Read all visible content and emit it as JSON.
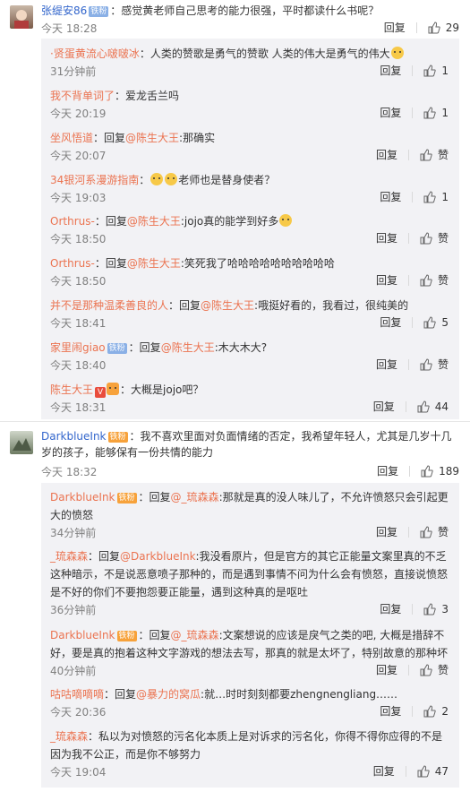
{
  "ui": {
    "reply_label": "回复",
    "like_label": "赞",
    "reply_prefix": "回复"
  },
  "comments": [
    {
      "user": "张缇安86",
      "badge": "铁粉",
      "text": "：感觉黄老师自己思考的能力很强，平时都读什么书呢？",
      "time": "今天 18:28",
      "likes": "29",
      "replies": [
        {
          "user": "·贤蛋黄流心啵啵冰",
          "text": "：人类的赞歌是勇气的赞歌 人类的伟大是勇气的伟大",
          "time": "31分钟前",
          "likes": "1"
        },
        {
          "user": "我不背单词了",
          "text": "：爱龙舌兰吗",
          "time": "今天 20:19",
          "likes": "1"
        },
        {
          "user": "坐风悟道",
          "text_pre": "：回复",
          "mention": "@陈生大王",
          "text": ":那确实",
          "time": "今天 20:07",
          "likes": "赞"
        },
        {
          "user": "34银河系漫游指南",
          "text": "：",
          "text2": "老师也是替身使者？",
          "time": "今天 19:03",
          "likes": "1"
        },
        {
          "user": "Orthrus-",
          "text_pre": "：回复",
          "mention": "@陈生大王",
          "text": ":jojo真的能学到好多",
          "time": "今天 18:50",
          "likes": "赞"
        },
        {
          "user": "Orthrus-",
          "text_pre": "：回复",
          "mention": "@陈生大王",
          "text": ":笑死我了哈哈哈哈哈哈哈哈哈哈",
          "time": "今天 18:50",
          "likes": "赞"
        },
        {
          "user": "并不是那种温柔善良的人",
          "text_pre": "：回复",
          "mention": "@陈生大王",
          "text": ":哦挺好看的，我看过，很纯美的",
          "time": "今天 18:41",
          "likes": "5"
        },
        {
          "user": "家里闹giao",
          "badge": "铁粉",
          "text_pre": "：回复",
          "mention": "@陈生大王",
          "text": ":木大木大?",
          "time": "今天 18:40",
          "likes": "赞"
        },
        {
          "user": "陈生大王",
          "text": "：大概是jojo吧？",
          "time": "今天 18:31",
          "likes": "44"
        }
      ]
    },
    {
      "user": "DarkblueInk",
      "badge": "铁粉",
      "text": "：我不喜欢里面对负面情绪的否定，我希望年轻人，尤其是几岁十几岁的孩子，能够保有一份共情的能力",
      "time": "今天 18:32",
      "likes": "189",
      "replies": [
        {
          "user": "DarkblueInk",
          "badge": "铁粉",
          "text_pre": "：回复",
          "mention": "@_琉森森",
          "text": ":那就是真的没人味儿了，不允许愤怒只会引起更大的愤怒",
          "time": "34分钟前",
          "likes": "赞"
        },
        {
          "user": "_琉森森",
          "text_pre": "：回复",
          "mention": "@DarkblueInk",
          "text": ":我没看原片，但是官方的其它正能量文案里真的不乏这种暗示，不是说恶意喷子那种的，而是遇到事情不问为什么会有愤怒，直接说愤怒是不好的你们不要抱怨要正能量，遇到这种真的是呕吐",
          "time": "36分钟前",
          "likes": "3"
        },
        {
          "user": "DarkblueInk",
          "badge": "铁粉",
          "text_pre": "：回复",
          "mention": "@_琉森森",
          "text": ":文案想说的应该是戾气之类的吧, 大概是措辞不好，要是真的抱着这种文字游戏的想法去写，那真的就是太坏了，特别故意的那种坏",
          "time": "40分钟前",
          "likes": "赞"
        },
        {
          "user": "咕咕嘀嘀嘀",
          "text_pre": "：回复",
          "mention": "@暴力的窝瓜",
          "text": ":就…时时刻刻都要zhengnengliang……",
          "time": "今天 20:36",
          "likes": "2"
        },
        {
          "user": "_琉森森",
          "text": "：私以为对愤怒的污名化本质上是对诉求的污名化，你得不得你应得的不是因为我不公正，而是你不够努力",
          "time": "今天 19:04",
          "likes": "47"
        }
      ]
    }
  ]
}
